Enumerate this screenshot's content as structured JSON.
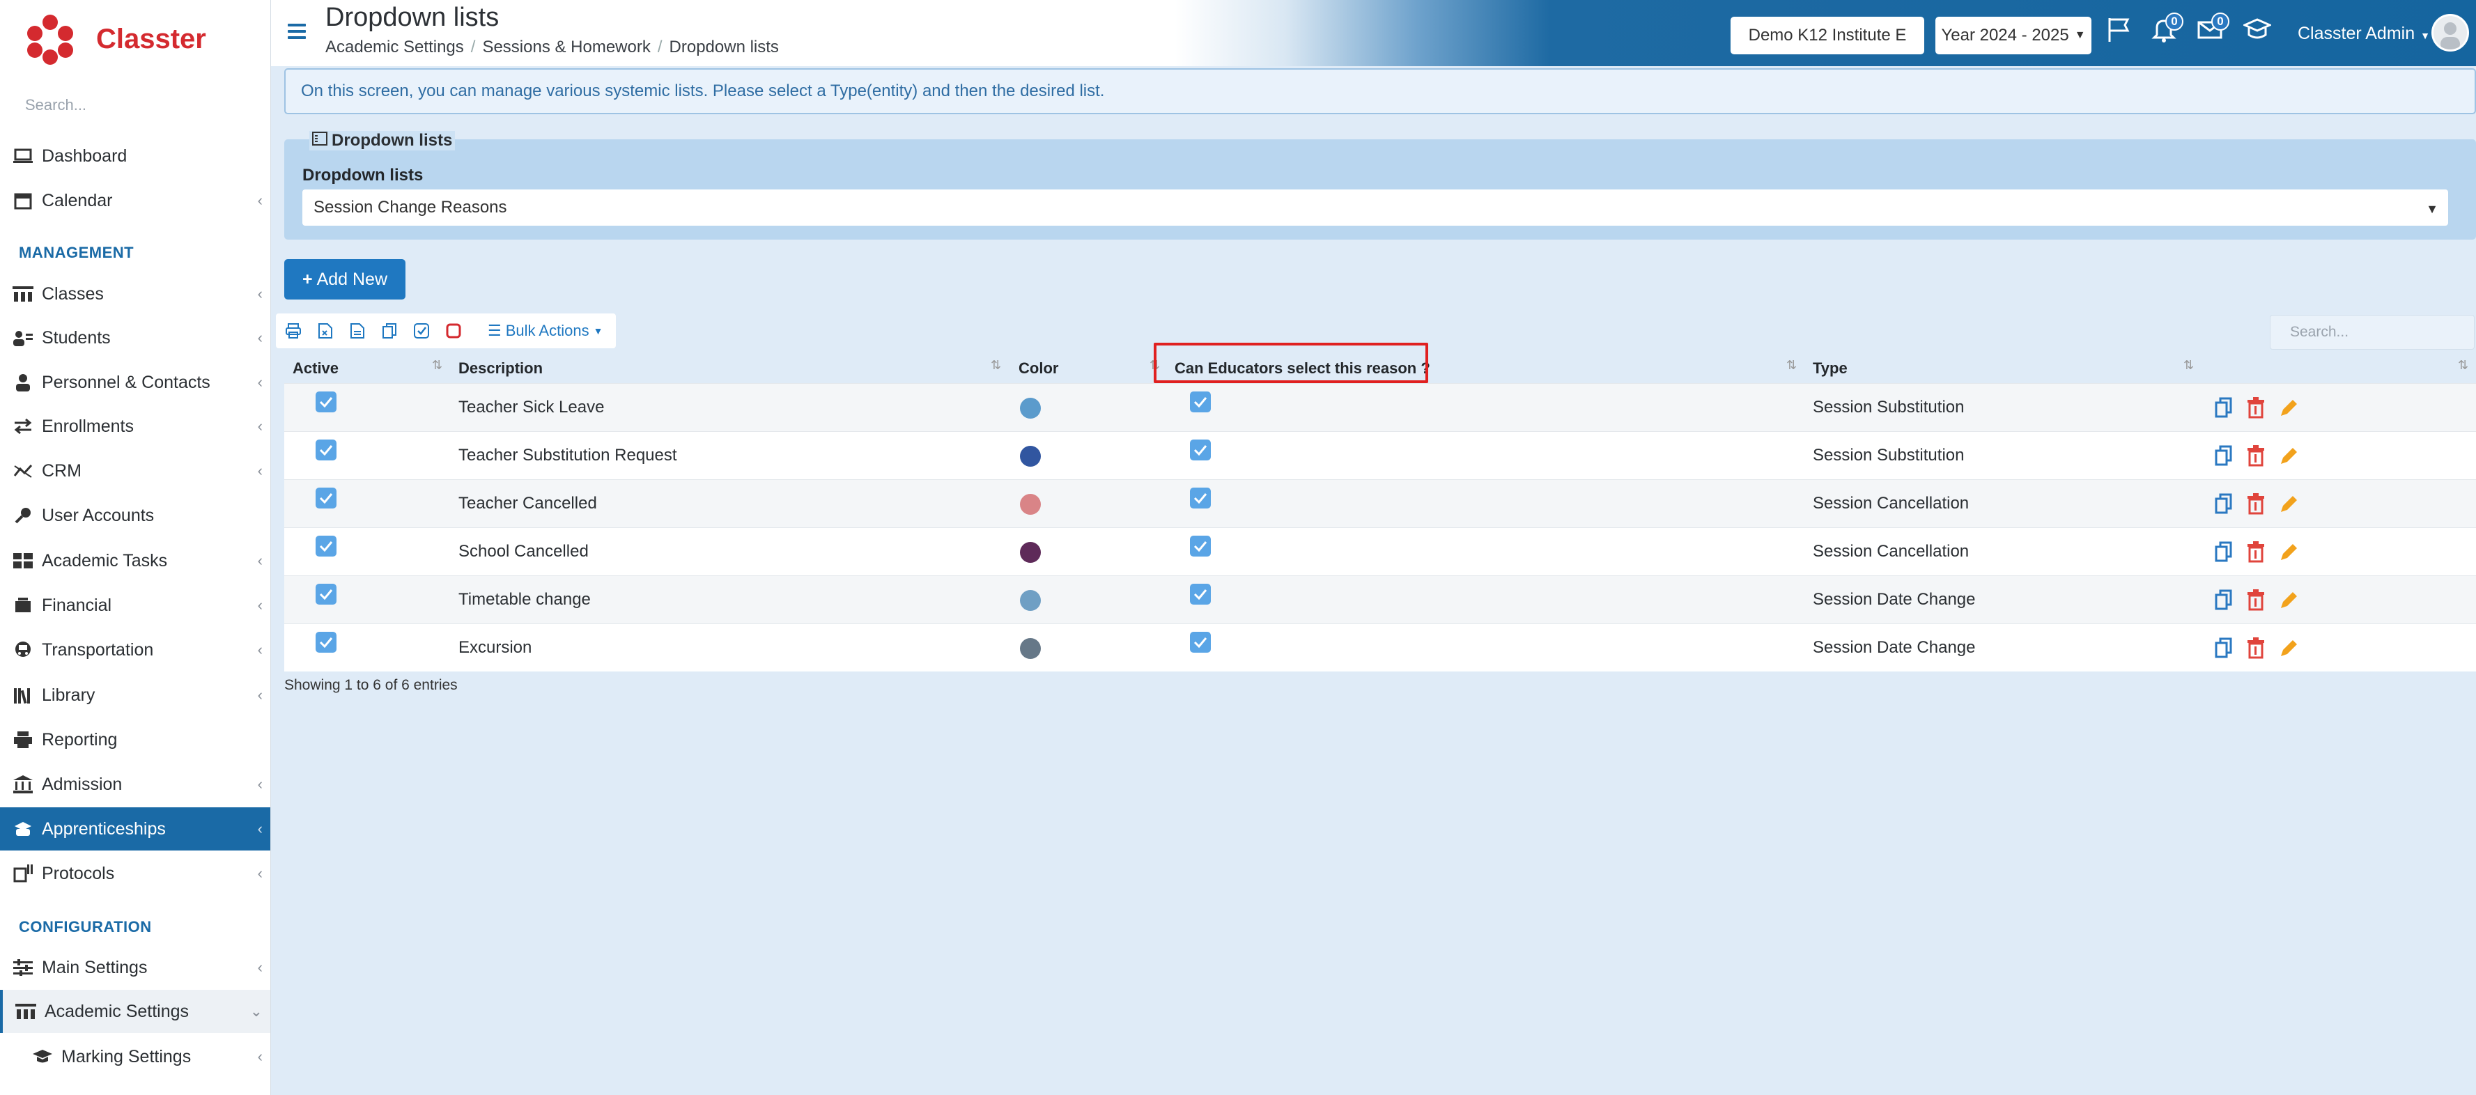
{
  "app": {
    "brand": "Classter",
    "brand_color": "#d42a2f",
    "accent": "#1a6aa6"
  },
  "sidebar": {
    "search_placeholder": "Search...",
    "items": [
      {
        "label": "Dashboard",
        "icon": "laptop-icon",
        "chevron": false
      },
      {
        "label": "Calendar",
        "icon": "calendar-icon",
        "chevron": true
      },
      {
        "label": "Classes",
        "icon": "classroom-icon",
        "chevron": true
      },
      {
        "label": "Students",
        "icon": "students-icon",
        "chevron": true
      },
      {
        "label": "Personnel & Contacts",
        "icon": "personnel-icon",
        "chevron": true
      },
      {
        "label": "Enrollments",
        "icon": "exchange-icon",
        "chevron": true
      },
      {
        "label": "CRM",
        "icon": "crm-icon",
        "chevron": true
      },
      {
        "label": "User Accounts",
        "icon": "key-icon",
        "chevron": false
      },
      {
        "label": "Academic Tasks",
        "icon": "grid-icon",
        "chevron": true
      },
      {
        "label": "Financial",
        "icon": "money-icon",
        "chevron": true
      },
      {
        "label": "Transportation",
        "icon": "bus-icon",
        "chevron": true
      },
      {
        "label": "Library",
        "icon": "books-icon",
        "chevron": true
      },
      {
        "label": "Reporting",
        "icon": "print-icon",
        "chevron": false
      },
      {
        "label": "Admission",
        "icon": "building-icon",
        "chevron": true
      },
      {
        "label": "Apprenticeships",
        "icon": "apprentice-icon",
        "chevron": true,
        "active": true
      },
      {
        "label": "Protocols",
        "icon": "protocols-icon",
        "chevron": true
      },
      {
        "label": "Main Settings",
        "icon": "sliders-icon",
        "chevron": true
      },
      {
        "label": "Academic Settings",
        "icon": "classroom-icon",
        "chevron": "down",
        "open": true
      },
      {
        "label": "Marking Settings",
        "icon": "graduation-cap-icon",
        "chevron": true,
        "sub": true
      }
    ],
    "sections": {
      "management": "MANAGEMENT",
      "configuration": "CONFIGURATION"
    }
  },
  "header": {
    "title": "Dropdown lists",
    "breadcrumbs": [
      "Academic Settings",
      "Sessions & Homework",
      "Dropdown lists"
    ],
    "institute": "Demo K12 Institute E",
    "year": "Year 2024 - 2025",
    "notifications_count": "0",
    "messages_count": "0",
    "user": "Classter Admin"
  },
  "main": {
    "info_text": "On this screen, you can manage various systemic lists. Please select a Type(entity) and then the desired list.",
    "panel_title": "Dropdown lists",
    "panel_label": "Dropdown lists",
    "selected_list": "Session Change Reasons",
    "add_button": "Add New",
    "bulk_actions": "Bulk Actions",
    "search_placeholder": "Search...",
    "footer": "Showing 1 to 6 of 6 entries"
  },
  "table": {
    "columns": [
      "Active",
      "Description",
      "Color",
      "Can Educators select this reason ?",
      "Type"
    ],
    "rows": [
      {
        "active": true,
        "description": "Teacher Sick Leave",
        "color": "#5b9bcc",
        "educators": true,
        "type": "Session Substitution"
      },
      {
        "active": true,
        "description": "Teacher Substitution Request",
        "color": "#3156a0",
        "educators": true,
        "type": "Session Substitution"
      },
      {
        "active": true,
        "description": "Teacher Cancelled",
        "color": "#d98487",
        "educators": true,
        "type": "Session Cancellation"
      },
      {
        "active": true,
        "description": "School Cancelled",
        "color": "#5e2a59",
        "educators": true,
        "type": "Session Cancellation"
      },
      {
        "active": true,
        "description": "Timetable change",
        "color": "#6f9fc4",
        "educators": true,
        "type": "Session Date Change"
      },
      {
        "active": true,
        "description": "Excursion",
        "color": "#667888",
        "educators": true,
        "type": "Session Date Change"
      }
    ]
  }
}
